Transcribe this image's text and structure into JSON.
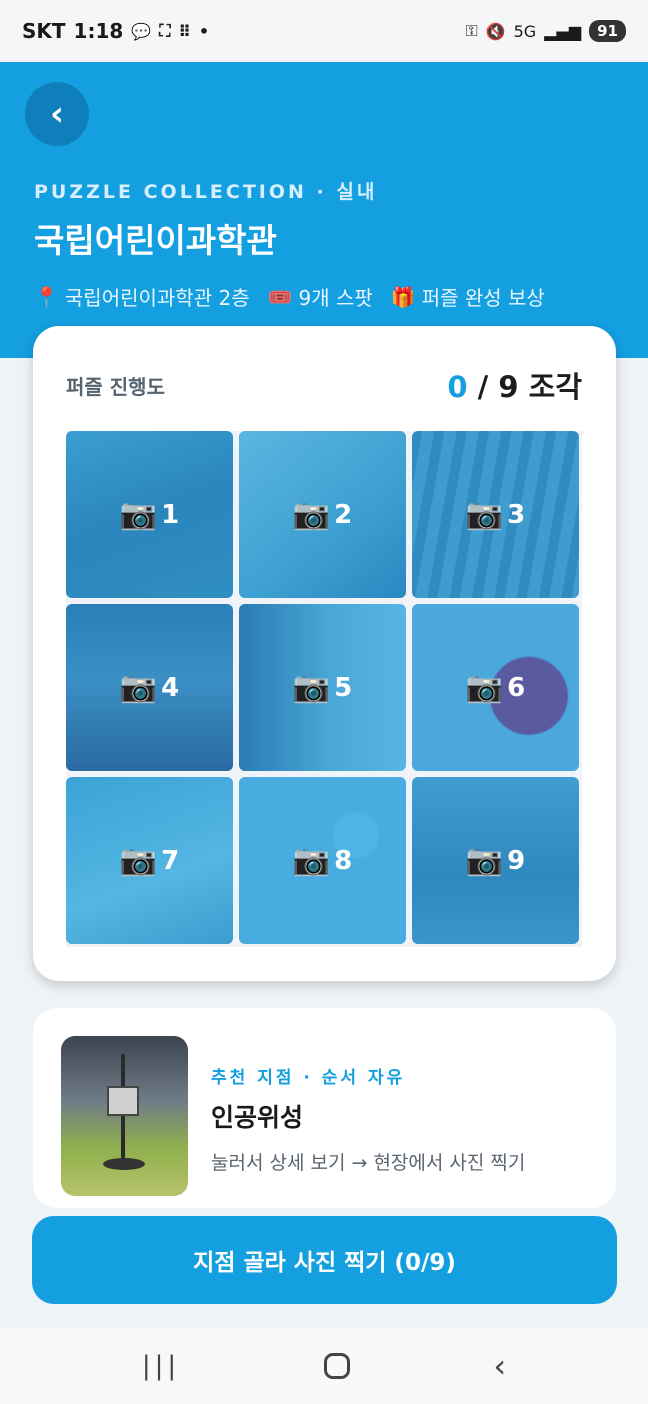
{
  "status_bar": {
    "carrier": "SKT",
    "time": "1:18",
    "icons_left": [
      "talk-icon",
      "capture-icon",
      "apps-icon",
      "dot-icon"
    ],
    "network": "5G",
    "battery": "91"
  },
  "header": {
    "eyebrow": "PUZZLE COLLECTION · 실내",
    "title": "국립어린이과학관",
    "meta": {
      "location": "국립어린이과학관 2층",
      "spots": "9개 스팟",
      "reward": "퍼즐 완성 보상"
    }
  },
  "puzzle": {
    "label": "퍼즐 진행도",
    "current": "0",
    "total": "/ 9 조각",
    "progress": 0,
    "tiles": [
      "1",
      "2",
      "3",
      "4",
      "5",
      "6",
      "7",
      "8",
      "9"
    ]
  },
  "recommend": {
    "tag": "추천 지점 · 순서 자유",
    "title": "인공위성",
    "desc": "눌러서 상세 보기 → 현장에서 사진 찍기"
  },
  "cta": {
    "label": "지점 골라 사진 찍기 (0/9)"
  },
  "colors": {
    "accent": "#139fe0",
    "accent_dark": "#0e7fba"
  }
}
